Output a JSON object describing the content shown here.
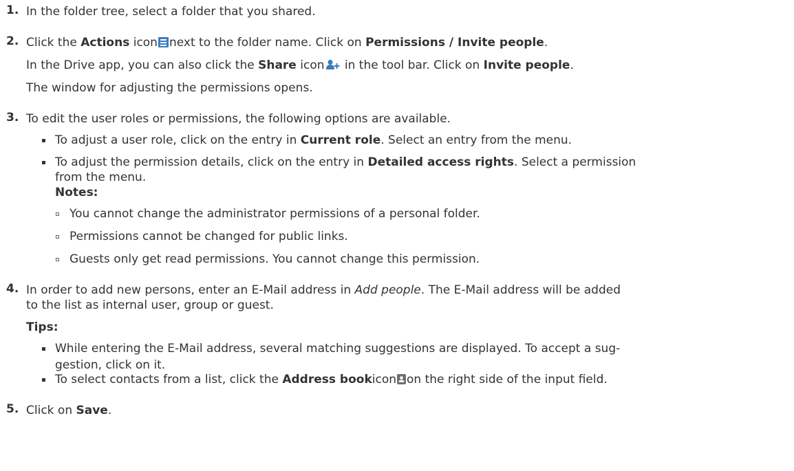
{
  "steps": [
    {
      "num": "1."
    },
    {
      "num": "2."
    },
    {
      "num": "3."
    },
    {
      "num": "4."
    },
    {
      "num": "5."
    }
  ],
  "s1": {
    "text": "In the folder tree, select a folder that you shared."
  },
  "s2": {
    "a1": "Click the ",
    "actions": "Actions",
    "a2": " icon",
    "a3": "next to the folder name. Click on ",
    "perm": "Permissions / Invite people",
    "a4": ".",
    "b1": "In the Drive app, you can also click the ",
    "share": "Share",
    "b2": " icon",
    "b3": " in the tool bar. Click on ",
    "invite": "Invite people",
    "b4": ".",
    "c": "The window for adjusting the permissions opens."
  },
  "s3": {
    "text": "To edit the user roles or permissions, the following options are available.",
    "bul1_a": "To adjust a user role, click on the entry in ",
    "bul1_b": "Current role",
    "bul1_c": ". Select an entry from the menu.",
    "bul2_a": "To adjust the permission details, click on the entry in ",
    "bul2_b": "Detailed access rights",
    "bul2_c": ". Select a permission",
    "bul2_d": "from the menu.",
    "notes": "Notes:",
    "n1": "You cannot change the administrator permissions of a personal folder.",
    "n2": "Permissions cannot be changed for public links.",
    "n3": "Guests only get read permissions. You cannot change this permission."
  },
  "s4": {
    "a1": "In order to add new persons, enter an E-Mail address in ",
    "addp": "Add people",
    "a2": ". The E-Mail address will be added",
    "b": "to the list as internal user, group or guest.",
    "tips": "Tips:",
    "t1a": "While entering the E-Mail address, several matching suggestions are displayed. To accept a sug-",
    "t1b": "gestion, click on it.",
    "t2a": "To select contacts from a list, click the ",
    "t2b": "Address book",
    "t2c": "icon",
    "t2d": "on the right side of the input field."
  },
  "s5": {
    "a": "Click on ",
    "save": "Save",
    "b": "."
  },
  "icons": {
    "actions": "actions-menu-icon",
    "share": "share-add-person-icon",
    "address_book": "address-book-icon",
    "accent": "#3b7bbf"
  }
}
